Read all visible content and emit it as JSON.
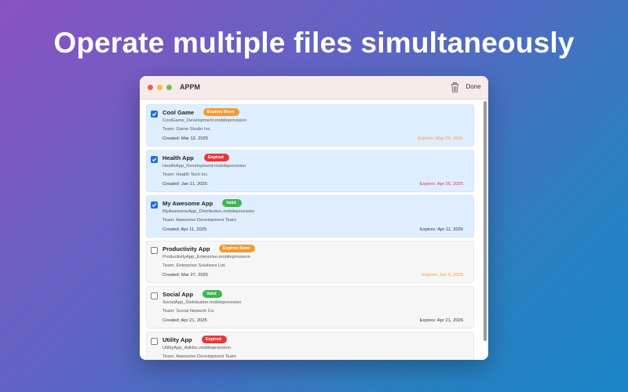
{
  "headline": "Operate multiple files simultaneously",
  "window": {
    "title": "APPM",
    "done_label": "Done"
  },
  "colors": {
    "expires_soon": "#f19b35",
    "expired": "#e8383c",
    "valid": "#3fb64f",
    "selected_bg": "#dfeefe",
    "checkbox_on": "#1f6fe0"
  },
  "profiles": [
    {
      "name": "Cool Game",
      "status": "Expires Soon",
      "status_kind": "soon",
      "file": "CoolGame_Development.mobileprovision",
      "team": "Team: Game Studio Inc.",
      "created": "Created: Mar 12, 2025",
      "expires": "Expires: May 26, 2025",
      "checked": true
    },
    {
      "name": "Health App",
      "status": "Expired",
      "status_kind": "expired",
      "file": "HealthApp_Development.mobileprovision",
      "team": "Team: Health Tech Inc.",
      "created": "Created: Jan 11, 2025",
      "expires": "Expires: Apr 26, 2025",
      "checked": true
    },
    {
      "name": "My Awesome App",
      "status": "Valid",
      "status_kind": "valid",
      "file": "MyAwesomeApp_Distribution.mobileprovision",
      "team": "Team: Awesome Development Team",
      "created": "Created: Apr 11, 2025",
      "expires": "Expires: Apr 11, 2026",
      "checked": true
    },
    {
      "name": "Productivity App",
      "status": "Expires Soon",
      "status_kind": "soon",
      "file": "ProductivityApp_Enterprise.mobileprovision",
      "team": "Team: Enterprise Solutions Ltd.",
      "created": "Created: Mar 27, 2025",
      "expires": "Expires: Jun 5, 2025",
      "checked": false
    },
    {
      "name": "Social App",
      "status": "Valid",
      "status_kind": "valid",
      "file": "SocialApp_Distribution.mobileprovision",
      "team": "Team: Social Network Co.",
      "created": "Created: Apr 21, 2025",
      "expires": "Expires: Apr 21, 2026",
      "checked": false
    },
    {
      "name": "Utility App",
      "status": "Expired",
      "status_kind": "expired",
      "file": "UtilityApp_AdHoc.mobileprovision",
      "team": "Team: Awesome Development Team",
      "created": "",
      "expires": "",
      "checked": false
    }
  ]
}
